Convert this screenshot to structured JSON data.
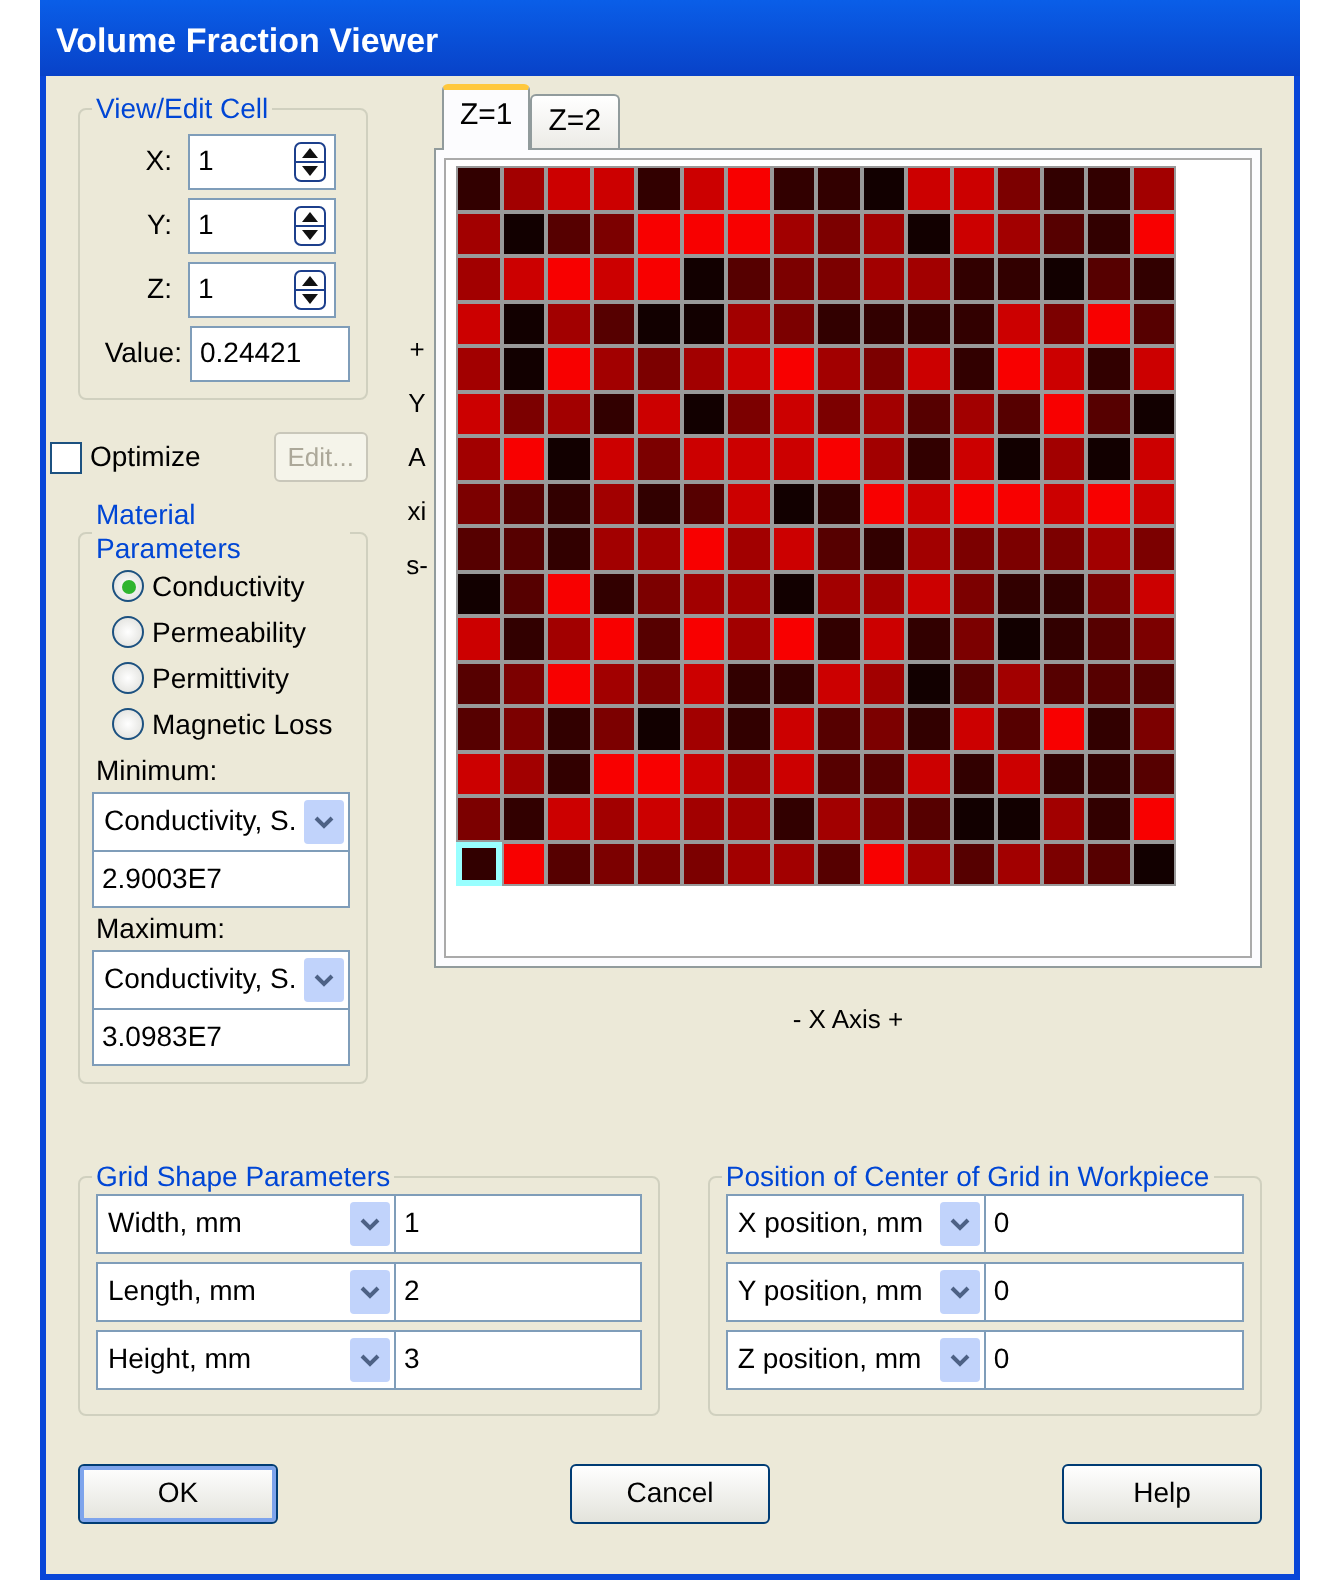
{
  "window": {
    "title": "Volume Fraction Viewer"
  },
  "view_edit_cell": {
    "title": "View/Edit Cell",
    "spinners": [
      {
        "label": "X:",
        "value": "1"
      },
      {
        "label": "Y:",
        "value": "1"
      },
      {
        "label": "Z:",
        "value": "1"
      }
    ],
    "value_label": "Value:",
    "value": "0.24421"
  },
  "optimize": {
    "label": "Optimize",
    "checked": false
  },
  "edit_button": {
    "label": "Edit...",
    "disabled": true
  },
  "material_parameters": {
    "title": "Material Parameters",
    "options": [
      {
        "label": "Conductivity",
        "selected": true
      },
      {
        "label": "Permeability",
        "selected": false
      },
      {
        "label": "Permittivity",
        "selected": false
      },
      {
        "label": "Magnetic Loss",
        "selected": false
      }
    ],
    "minimum": {
      "label": "Minimum:",
      "unit": "Conductivity, S.",
      "value": "2.9003E7"
    },
    "maximum": {
      "label": "Maximum:",
      "unit": "Conductivity, S.",
      "value": "3.0983E7"
    }
  },
  "y_axis_label": "+YAxis-",
  "tabs": [
    {
      "label": "Z=1",
      "selected": true
    },
    {
      "label": "Z=2",
      "selected": false
    }
  ],
  "grid": {
    "rows": [
      [
        {
          "color": "#320000",
          "selected": false
        },
        {
          "color": "#a20000",
          "selected": false
        },
        {
          "color": "#cc0000",
          "selected": false
        },
        {
          "color": "#cc0000",
          "selected": false
        },
        {
          "color": "#320000",
          "selected": false
        },
        {
          "color": "#cc0000",
          "selected": false
        },
        {
          "color": "#f80000",
          "selected": false
        },
        {
          "color": "#320000",
          "selected": false
        },
        {
          "color": "#320000",
          "selected": false
        },
        {
          "color": "#120000",
          "selected": false
        },
        {
          "color": "#cc0000",
          "selected": false
        },
        {
          "color": "#cc0000",
          "selected": false
        },
        {
          "color": "#7c0000",
          "selected": false
        },
        {
          "color": "#320000",
          "selected": false
        },
        {
          "color": "#320000",
          "selected": false
        },
        {
          "color": "#a20000",
          "selected": false
        }
      ],
      [
        {
          "color": "#a20000",
          "selected": false
        },
        {
          "color": "#120000",
          "selected": false
        },
        {
          "color": "#560000",
          "selected": false
        },
        {
          "color": "#7c0000",
          "selected": false
        },
        {
          "color": "#f80000",
          "selected": false
        },
        {
          "color": "#f80000",
          "selected": false
        },
        {
          "color": "#f80000",
          "selected": false
        },
        {
          "color": "#a20000",
          "selected": false
        },
        {
          "color": "#7c0000",
          "selected": false
        },
        {
          "color": "#a20000",
          "selected": false
        },
        {
          "color": "#120000",
          "selected": false
        },
        {
          "color": "#cc0000",
          "selected": false
        },
        {
          "color": "#a20000",
          "selected": false
        },
        {
          "color": "#560000",
          "selected": false
        },
        {
          "color": "#320000",
          "selected": false
        },
        {
          "color": "#f80000",
          "selected": false
        }
      ],
      [
        {
          "color": "#a20000",
          "selected": false
        },
        {
          "color": "#cc0000",
          "selected": false
        },
        {
          "color": "#f80000",
          "selected": false
        },
        {
          "color": "#cc0000",
          "selected": false
        },
        {
          "color": "#f80000",
          "selected": false
        },
        {
          "color": "#120000",
          "selected": false
        },
        {
          "color": "#560000",
          "selected": false
        },
        {
          "color": "#7c0000",
          "selected": false
        },
        {
          "color": "#7c0000",
          "selected": false
        },
        {
          "color": "#a20000",
          "selected": false
        },
        {
          "color": "#a20000",
          "selected": false
        },
        {
          "color": "#320000",
          "selected": false
        },
        {
          "color": "#320000",
          "selected": false
        },
        {
          "color": "#120000",
          "selected": false
        },
        {
          "color": "#560000",
          "selected": false
        },
        {
          "color": "#320000",
          "selected": false
        }
      ],
      [
        {
          "color": "#cc0000",
          "selected": false
        },
        {
          "color": "#120000",
          "selected": false
        },
        {
          "color": "#a20000",
          "selected": false
        },
        {
          "color": "#560000",
          "selected": false
        },
        {
          "color": "#120000",
          "selected": false
        },
        {
          "color": "#120000",
          "selected": false
        },
        {
          "color": "#a20000",
          "selected": false
        },
        {
          "color": "#7c0000",
          "selected": false
        },
        {
          "color": "#320000",
          "selected": false
        },
        {
          "color": "#320000",
          "selected": false
        },
        {
          "color": "#320000",
          "selected": false
        },
        {
          "color": "#320000",
          "selected": false
        },
        {
          "color": "#cc0000",
          "selected": false
        },
        {
          "color": "#7c0000",
          "selected": false
        },
        {
          "color": "#f80000",
          "selected": false
        },
        {
          "color": "#560000",
          "selected": false
        }
      ],
      [
        {
          "color": "#a20000",
          "selected": false
        },
        {
          "color": "#120000",
          "selected": false
        },
        {
          "color": "#f80000",
          "selected": false
        },
        {
          "color": "#a20000",
          "selected": false
        },
        {
          "color": "#7c0000",
          "selected": false
        },
        {
          "color": "#a20000",
          "selected": false
        },
        {
          "color": "#cc0000",
          "selected": false
        },
        {
          "color": "#f80000",
          "selected": false
        },
        {
          "color": "#a20000",
          "selected": false
        },
        {
          "color": "#7c0000",
          "selected": false
        },
        {
          "color": "#cc0000",
          "selected": false
        },
        {
          "color": "#320000",
          "selected": false
        },
        {
          "color": "#f80000",
          "selected": false
        },
        {
          "color": "#cc0000",
          "selected": false
        },
        {
          "color": "#320000",
          "selected": false
        },
        {
          "color": "#cc0000",
          "selected": false
        }
      ],
      [
        {
          "color": "#cc0000",
          "selected": false
        },
        {
          "color": "#7c0000",
          "selected": false
        },
        {
          "color": "#a20000",
          "selected": false
        },
        {
          "color": "#320000",
          "selected": false
        },
        {
          "color": "#cc0000",
          "selected": false
        },
        {
          "color": "#120000",
          "selected": false
        },
        {
          "color": "#7c0000",
          "selected": false
        },
        {
          "color": "#cc0000",
          "selected": false
        },
        {
          "color": "#7c0000",
          "selected": false
        },
        {
          "color": "#a20000",
          "selected": false
        },
        {
          "color": "#560000",
          "selected": false
        },
        {
          "color": "#a20000",
          "selected": false
        },
        {
          "color": "#560000",
          "selected": false
        },
        {
          "color": "#f80000",
          "selected": false
        },
        {
          "color": "#560000",
          "selected": false
        },
        {
          "color": "#120000",
          "selected": false
        }
      ],
      [
        {
          "color": "#a20000",
          "selected": false
        },
        {
          "color": "#f80000",
          "selected": false
        },
        {
          "color": "#120000",
          "selected": false
        },
        {
          "color": "#cc0000",
          "selected": false
        },
        {
          "color": "#7c0000",
          "selected": false
        },
        {
          "color": "#cc0000",
          "selected": false
        },
        {
          "color": "#cc0000",
          "selected": false
        },
        {
          "color": "#cc0000",
          "selected": false
        },
        {
          "color": "#f80000",
          "selected": false
        },
        {
          "color": "#a20000",
          "selected": false
        },
        {
          "color": "#320000",
          "selected": false
        },
        {
          "color": "#cc0000",
          "selected": false
        },
        {
          "color": "#120000",
          "selected": false
        },
        {
          "color": "#a20000",
          "selected": false
        },
        {
          "color": "#120000",
          "selected": false
        },
        {
          "color": "#cc0000",
          "selected": false
        }
      ],
      [
        {
          "color": "#7c0000",
          "selected": false
        },
        {
          "color": "#560000",
          "selected": false
        },
        {
          "color": "#320000",
          "selected": false
        },
        {
          "color": "#a20000",
          "selected": false
        },
        {
          "color": "#320000",
          "selected": false
        },
        {
          "color": "#560000",
          "selected": false
        },
        {
          "color": "#cc0000",
          "selected": false
        },
        {
          "color": "#120000",
          "selected": false
        },
        {
          "color": "#320000",
          "selected": false
        },
        {
          "color": "#f80000",
          "selected": false
        },
        {
          "color": "#cc0000",
          "selected": false
        },
        {
          "color": "#f80000",
          "selected": false
        },
        {
          "color": "#f80000",
          "selected": false
        },
        {
          "color": "#cc0000",
          "selected": false
        },
        {
          "color": "#f80000",
          "selected": false
        },
        {
          "color": "#cc0000",
          "selected": false
        }
      ],
      [
        {
          "color": "#560000",
          "selected": false
        },
        {
          "color": "#560000",
          "selected": false
        },
        {
          "color": "#320000",
          "selected": false
        },
        {
          "color": "#a20000",
          "selected": false
        },
        {
          "color": "#a20000",
          "selected": false
        },
        {
          "color": "#f80000",
          "selected": false
        },
        {
          "color": "#a20000",
          "selected": false
        },
        {
          "color": "#cc0000",
          "selected": false
        },
        {
          "color": "#560000",
          "selected": false
        },
        {
          "color": "#320000",
          "selected": false
        },
        {
          "color": "#a20000",
          "selected": false
        },
        {
          "color": "#7c0000",
          "selected": false
        },
        {
          "color": "#7c0000",
          "selected": false
        },
        {
          "color": "#7c0000",
          "selected": false
        },
        {
          "color": "#a20000",
          "selected": false
        },
        {
          "color": "#7c0000",
          "selected": false
        }
      ],
      [
        {
          "color": "#120000",
          "selected": false
        },
        {
          "color": "#560000",
          "selected": false
        },
        {
          "color": "#f80000",
          "selected": false
        },
        {
          "color": "#320000",
          "selected": false
        },
        {
          "color": "#7c0000",
          "selected": false
        },
        {
          "color": "#a20000",
          "selected": false
        },
        {
          "color": "#a20000",
          "selected": false
        },
        {
          "color": "#120000",
          "selected": false
        },
        {
          "color": "#a20000",
          "selected": false
        },
        {
          "color": "#a20000",
          "selected": false
        },
        {
          "color": "#cc0000",
          "selected": false
        },
        {
          "color": "#7c0000",
          "selected": false
        },
        {
          "color": "#320000",
          "selected": false
        },
        {
          "color": "#320000",
          "selected": false
        },
        {
          "color": "#7c0000",
          "selected": false
        },
        {
          "color": "#cc0000",
          "selected": false
        }
      ],
      [
        {
          "color": "#cc0000",
          "selected": false
        },
        {
          "color": "#320000",
          "selected": false
        },
        {
          "color": "#a20000",
          "selected": false
        },
        {
          "color": "#f80000",
          "selected": false
        },
        {
          "color": "#560000",
          "selected": false
        },
        {
          "color": "#f80000",
          "selected": false
        },
        {
          "color": "#a20000",
          "selected": false
        },
        {
          "color": "#f80000",
          "selected": false
        },
        {
          "color": "#320000",
          "selected": false
        },
        {
          "color": "#cc0000",
          "selected": false
        },
        {
          "color": "#320000",
          "selected": false
        },
        {
          "color": "#7c0000",
          "selected": false
        },
        {
          "color": "#120000",
          "selected": false
        },
        {
          "color": "#320000",
          "selected": false
        },
        {
          "color": "#560000",
          "selected": false
        },
        {
          "color": "#7c0000",
          "selected": false
        }
      ],
      [
        {
          "color": "#560000",
          "selected": false
        },
        {
          "color": "#7c0000",
          "selected": false
        },
        {
          "color": "#f80000",
          "selected": false
        },
        {
          "color": "#a20000",
          "selected": false
        },
        {
          "color": "#7c0000",
          "selected": false
        },
        {
          "color": "#cc0000",
          "selected": false
        },
        {
          "color": "#320000",
          "selected": false
        },
        {
          "color": "#320000",
          "selected": false
        },
        {
          "color": "#cc0000",
          "selected": false
        },
        {
          "color": "#a20000",
          "selected": false
        },
        {
          "color": "#120000",
          "selected": false
        },
        {
          "color": "#560000",
          "selected": false
        },
        {
          "color": "#a20000",
          "selected": false
        },
        {
          "color": "#560000",
          "selected": false
        },
        {
          "color": "#560000",
          "selected": false
        },
        {
          "color": "#560000",
          "selected": false
        }
      ],
      [
        {
          "color": "#560000",
          "selected": false
        },
        {
          "color": "#7c0000",
          "selected": false
        },
        {
          "color": "#320000",
          "selected": false
        },
        {
          "color": "#7c0000",
          "selected": false
        },
        {
          "color": "#120000",
          "selected": false
        },
        {
          "color": "#a20000",
          "selected": false
        },
        {
          "color": "#320000",
          "selected": false
        },
        {
          "color": "#cc0000",
          "selected": false
        },
        {
          "color": "#560000",
          "selected": false
        },
        {
          "color": "#7c0000",
          "selected": false
        },
        {
          "color": "#320000",
          "selected": false
        },
        {
          "color": "#cc0000",
          "selected": false
        },
        {
          "color": "#560000",
          "selected": false
        },
        {
          "color": "#f80000",
          "selected": false
        },
        {
          "color": "#320000",
          "selected": false
        },
        {
          "color": "#7c0000",
          "selected": false
        }
      ],
      [
        {
          "color": "#cc0000",
          "selected": false
        },
        {
          "color": "#a20000",
          "selected": false
        },
        {
          "color": "#320000",
          "selected": false
        },
        {
          "color": "#f80000",
          "selected": false
        },
        {
          "color": "#f80000",
          "selected": false
        },
        {
          "color": "#cc0000",
          "selected": false
        },
        {
          "color": "#a20000",
          "selected": false
        },
        {
          "color": "#cc0000",
          "selected": false
        },
        {
          "color": "#560000",
          "selected": false
        },
        {
          "color": "#560000",
          "selected": false
        },
        {
          "color": "#cc0000",
          "selected": false
        },
        {
          "color": "#320000",
          "selected": false
        },
        {
          "color": "#cc0000",
          "selected": false
        },
        {
          "color": "#320000",
          "selected": false
        },
        {
          "color": "#320000",
          "selected": false
        },
        {
          "color": "#560000",
          "selected": false
        }
      ],
      [
        {
          "color": "#7c0000",
          "selected": false
        },
        {
          "color": "#320000",
          "selected": false
        },
        {
          "color": "#cc0000",
          "selected": false
        },
        {
          "color": "#a20000",
          "selected": false
        },
        {
          "color": "#cc0000",
          "selected": false
        },
        {
          "color": "#a20000",
          "selected": false
        },
        {
          "color": "#a20000",
          "selected": false
        },
        {
          "color": "#320000",
          "selected": false
        },
        {
          "color": "#a20000",
          "selected": false
        },
        {
          "color": "#7c0000",
          "selected": false
        },
        {
          "color": "#560000",
          "selected": false
        },
        {
          "color": "#120000",
          "selected": false
        },
        {
          "color": "#120000",
          "selected": false
        },
        {
          "color": "#a20000",
          "selected": false
        },
        {
          "color": "#320000",
          "selected": false
        },
        {
          "color": "#f80000",
          "selected": false
        }
      ],
      [
        {
          "color": "#320000",
          "selected": true
        },
        {
          "color": "#f80000",
          "selected": false
        },
        {
          "color": "#560000",
          "selected": false
        },
        {
          "color": "#7c0000",
          "selected": false
        },
        {
          "color": "#7c0000",
          "selected": false
        },
        {
          "color": "#7c0000",
          "selected": false
        },
        {
          "color": "#a20000",
          "selected": false
        },
        {
          "color": "#a20000",
          "selected": false
        },
        {
          "color": "#560000",
          "selected": false
        },
        {
          "color": "#f80000",
          "selected": false
        },
        {
          "color": "#a20000",
          "selected": false
        },
        {
          "color": "#560000",
          "selected": false
        },
        {
          "color": "#a20000",
          "selected": false
        },
        {
          "color": "#7c0000",
          "selected": false
        },
        {
          "color": "#560000",
          "selected": false
        },
        {
          "color": "#120000",
          "selected": false
        }
      ]
    ]
  },
  "x_axis_label": "- X Axis +",
  "grid_shape_parameters": {
    "title": "Grid Shape Parameters",
    "rows": [
      {
        "unit": "Width, mm",
        "value": "1"
      },
      {
        "unit": "Length, mm",
        "value": "2"
      },
      {
        "unit": "Height, mm",
        "value": "3"
      }
    ]
  },
  "grid_center_position": {
    "title": "Position of Center of Grid in Workpiece",
    "rows": [
      {
        "unit": "X position, mm",
        "value": "0"
      },
      {
        "unit": "Y position, mm",
        "value": "0"
      },
      {
        "unit": "Z position, mm",
        "value": "0"
      }
    ]
  },
  "buttons": [
    {
      "label": "OK",
      "default": true
    },
    {
      "label": "Cancel",
      "default": false
    },
    {
      "label": "Help",
      "default": false
    }
  ]
}
